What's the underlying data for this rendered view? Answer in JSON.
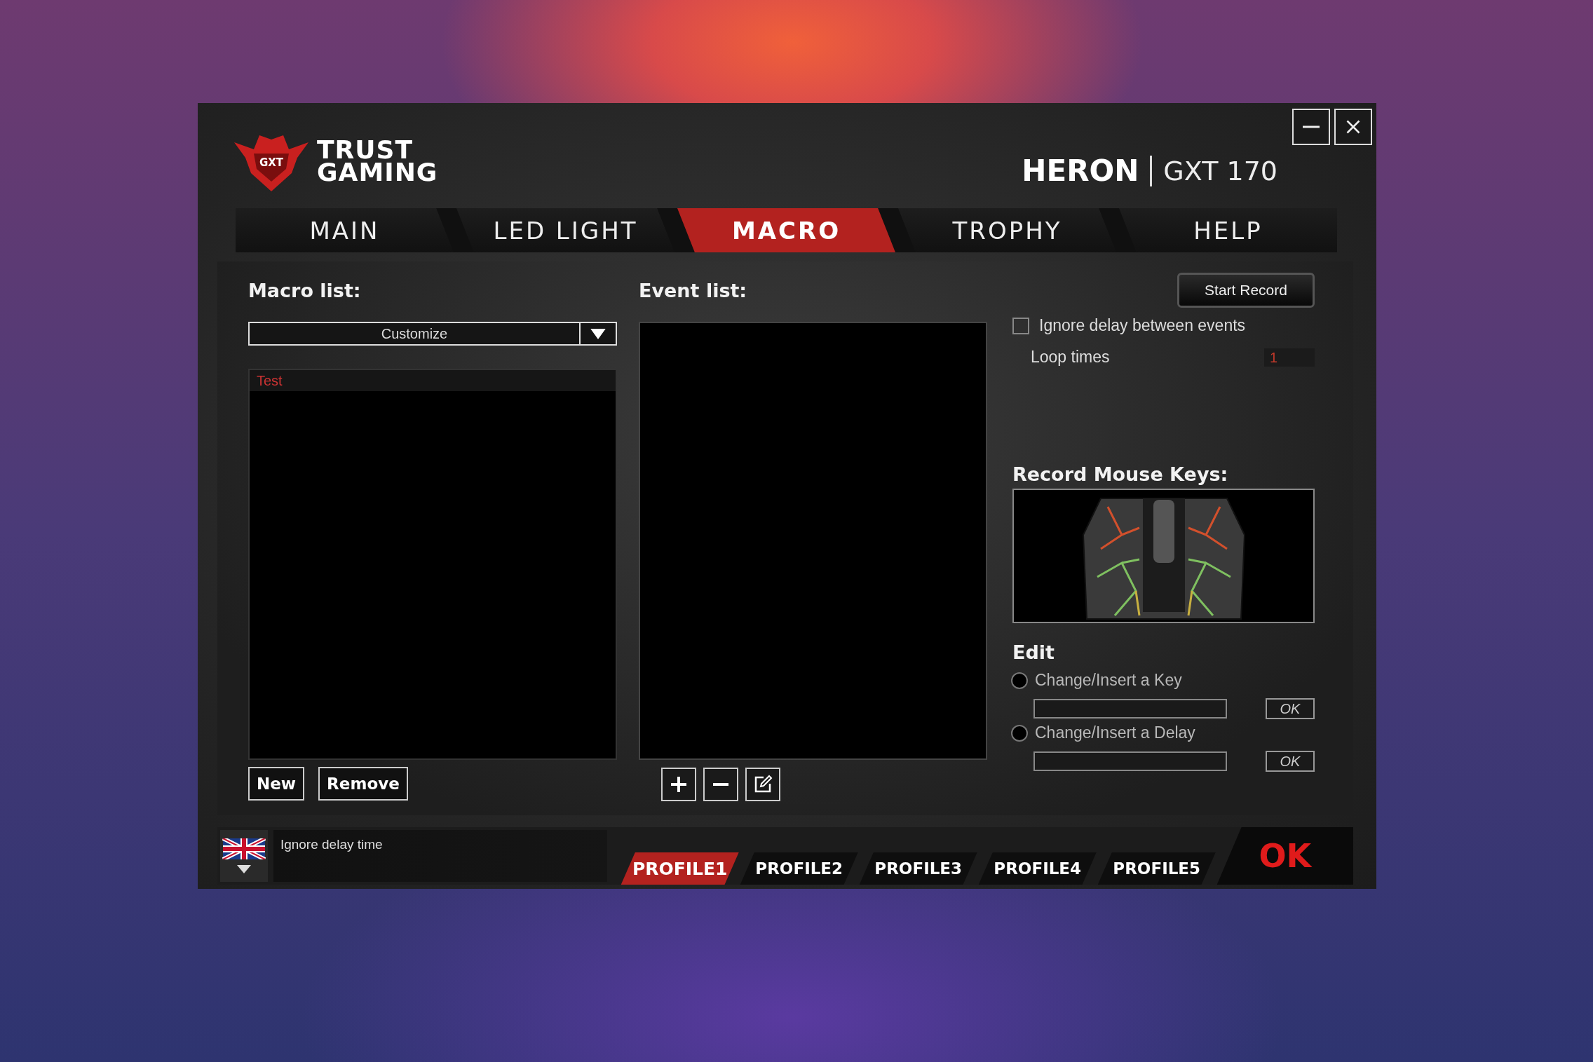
{
  "window": {
    "badge_text": "GXT",
    "brand_lines": [
      "TRUST",
      "GAMING"
    ],
    "model_name": "HERON",
    "model_number": "GXT 170"
  },
  "tabs": [
    {
      "label": "MAIN",
      "selected": false
    },
    {
      "label": "LED LIGHT",
      "selected": false
    },
    {
      "label": "MACRO",
      "selected": true
    },
    {
      "label": "TROPHY",
      "selected": false
    },
    {
      "label": "HELP",
      "selected": false
    }
  ],
  "macro_list": {
    "label": "Macro list:",
    "dropdown_value": "Customize",
    "items": [
      {
        "label": "Test",
        "selected": true
      }
    ],
    "buttons": [
      "New",
      "Remove"
    ]
  },
  "event_list": {
    "label": "Event list:"
  },
  "recording": {
    "start_button": "Start Record",
    "ignore_delay": {
      "label": "Ignore delay between events",
      "checked": false
    },
    "loop_times": {
      "label": "Loop times",
      "value": "1"
    }
  },
  "record_mouse_keys": {
    "label": "Record Mouse Keys:"
  },
  "edit": {
    "label": "Edit",
    "options": [
      {
        "label": "Change/Insert a Key",
        "selected": false,
        "button": "OK"
      },
      {
        "label": "Change/Insert a Delay",
        "selected": false,
        "button": "OK"
      }
    ]
  },
  "footer": {
    "status_text": "Ignore delay time",
    "profiles": [
      {
        "label": "PROFILE1",
        "selected": true
      },
      {
        "label": "PROFILE2",
        "selected": false
      },
      {
        "label": "PROFILE3",
        "selected": false
      },
      {
        "label": "PROFILE4",
        "selected": false
      },
      {
        "label": "PROFILE5",
        "selected": false
      }
    ],
    "ok_button": "OK"
  }
}
